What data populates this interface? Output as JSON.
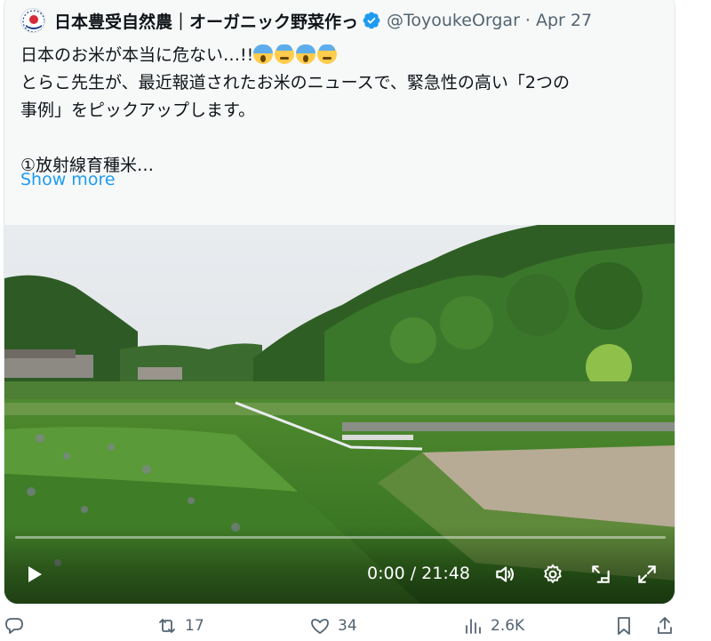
{
  "tweet": {
    "author_name": "日本豊受自然農｜オーガニック野菜作っ",
    "handle": "@ToyoukeOrgar",
    "separator": "·",
    "date": "Apr 27",
    "line1": "日本のお米が本当に危ない…!!",
    "line2": "とらこ先生が、最近報道されたお米のニュースで、緊急性の高い「2つの",
    "line3": "事例」をピックアップします。",
    "line4": "①放射線育種米…",
    "show_more": "Show more",
    "emoji_icons": [
      "face-screaming-icon",
      "anxious-sweat-icon",
      "face-screaming-icon",
      "anxious-sweat-icon"
    ]
  },
  "video": {
    "time_display": "0:00 / 21:48",
    "progress": 0.0
  },
  "actions": {
    "retweets": "17",
    "likes": "34",
    "views": "2.6K"
  },
  "colors": {
    "accent": "#1d9bf0",
    "muted": "#536471",
    "card_bg": "#f7f9f9"
  }
}
